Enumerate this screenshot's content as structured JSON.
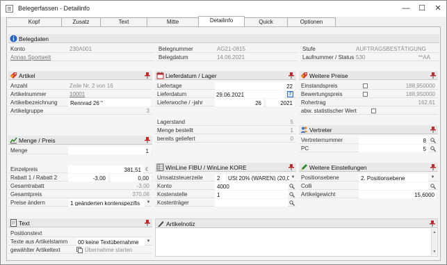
{
  "window": {
    "title": "Belegerfassen - Detailinfo",
    "minimize": "—",
    "maximize": "☐",
    "close": "✕"
  },
  "tabs": [
    "Kopf",
    "Zusatz",
    "Text",
    "Mitte",
    "Detailinfo",
    "Quick",
    "Optionen"
  ],
  "belegdaten": {
    "title": "Belegdaten",
    "konto_label": "Konto",
    "konto_value": "230A001",
    "kunde": "Annas Sportwelt",
    "belegnummer_label": "Belegnummer",
    "belegnummer_value": "AG21-0815",
    "belegdatum_label": "Belegdatum",
    "belegdatum_value": "14.06.2021",
    "stufe_label": "Stufe",
    "stufe_value": "AUFTRAGSBESTÄTIGUNG",
    "lauf_label": "Laufnummer / Status",
    "lauf_value": "530",
    "status_value": "**AA"
  },
  "artikel": {
    "title": "Artikel",
    "anzahl_label": "Anzahl",
    "anzahl_value": "Zeile Nr. 2 von 16",
    "nummer_label": "Artikelnummer",
    "nummer_value": "10001",
    "bez_label": "Artikelbezeichnung",
    "bez_value": "Rennrad 26 \"",
    "gruppe_label": "Artikelgruppe",
    "gruppe_value": "3"
  },
  "liefer": {
    "title": "Lieferdatum / Lager",
    "tage_label": "Liefertage",
    "tage_value": "22",
    "datum_label": "Lieferdatum",
    "datum_value": "29.06.2021",
    "cal_value": "7",
    "woche_label": "Lieferwoche / -jahr",
    "woche_value": "26",
    "jahr_value": "2021",
    "stand_label": "Lagerstand",
    "stand_value": "5",
    "bestellt_label": "Menge bestellt",
    "bestellt_value": "1",
    "geliefert_label": "bereits geliefert",
    "geliefert_value": "0"
  },
  "preise": {
    "title": "Weitere Preise",
    "einstand_label": "Einstandspreis",
    "einstand_value": "188,950000",
    "bewertung_label": "Bewertungspreis",
    "bewertung_value": "188,950000",
    "rohertrag_label": "Rohertrag",
    "rohertrag_value": "162,61",
    "abw_label": "abw. statistischer Wert"
  },
  "vertreter": {
    "title": "Vertreter",
    "nummer_label": "Vertreternummer",
    "nummer_value": "8",
    "pc_label": "PC",
    "pc_value": "5"
  },
  "menge": {
    "title": "Menge / Preis",
    "menge_label": "Menge",
    "menge_value": "1",
    "einzel_label": "Einzelpreis",
    "einzel_value": "381,51",
    "currency": "€",
    "rabatt_label": "Rabatt 1 / Rabatt 2",
    "rabatt1_value": "-3,00",
    "rabatt2_value": "0,00",
    "gesamtrabatt_label": "Gesamtrabatt",
    "gesamtrabatt_value": "-3,00",
    "gesamtpreis_label": "Gesamtpreis",
    "gesamtpreis_value": "370,06",
    "aendern_label": "Preise ändern",
    "aendern_value": "1 geänderten kontenspezifis"
  },
  "fibu": {
    "title": "WinLine FIBU / WinLine KORE",
    "steuer_label": "Umsatzsteuerzeile",
    "steuer_nr": "2",
    "steuer_value": "USt 20% (WAREN) (20,0",
    "konto_label": "Konto",
    "konto_value": "4000",
    "kst_label": "Kostenstelle",
    "kst_value": "1",
    "ktr_label": "Kostenträger",
    "ktr_value": ""
  },
  "einstellungen": {
    "title": "Weitere Einstellungen",
    "pos_label": "Positionsebene",
    "pos_value": "2. Positionsebene",
    "colli_label": "Colli",
    "colli_value": "",
    "gewicht_label": "Artikelgewicht",
    "gewicht_value": "15,6000"
  },
  "text": {
    "title": "Text",
    "positionstext_label": "Positionstext",
    "stamm_label": "Texte aus Artikelstamm",
    "stamm_value": "00  keine Textübernahme",
    "gewaehlt_label": "gewählter Artikeltext",
    "gewaehlt_value": "Übernahme starten"
  },
  "notiz": {
    "title": "Artikelnotiz"
  }
}
